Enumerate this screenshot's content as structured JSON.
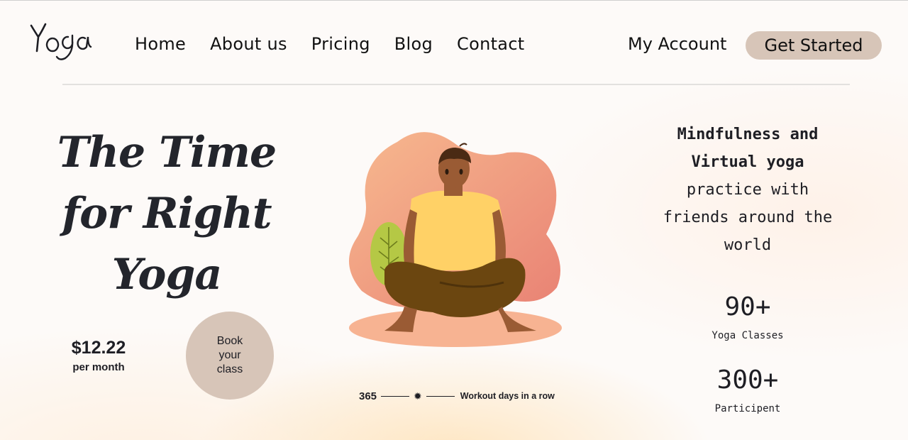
{
  "brand": {
    "logo_text": "Yoga"
  },
  "nav": {
    "items": [
      "Home",
      "About us",
      "Pricing",
      "Blog",
      "Contact"
    ],
    "account": "My Account",
    "cta": "Get Started"
  },
  "hero": {
    "title_lines": [
      "The Time",
      "for Right",
      "Yoga"
    ],
    "price": "$12.22",
    "price_unit": "per month",
    "book_label": "Book your class"
  },
  "illustration": {
    "icon": "meditating-person-illustration"
  },
  "streak": {
    "count": "365",
    "icon": "sparkle-icon",
    "label": "Workout days in a row"
  },
  "tagline": {
    "bold_lines": [
      "Mindfulness and",
      "Virtual yoga"
    ],
    "rest_lines": [
      "practice with",
      "friends around the",
      "world"
    ]
  },
  "stats": [
    {
      "value": "90+",
      "label": "Yoga Classes"
    },
    {
      "value": "300+",
      "label": "Participent"
    }
  ],
  "colors": {
    "accent": "#d7c5b8",
    "text": "#1e1e24",
    "blob": "#ef9a7f",
    "shirt": "#ffd166",
    "pants": "#6b4610"
  }
}
